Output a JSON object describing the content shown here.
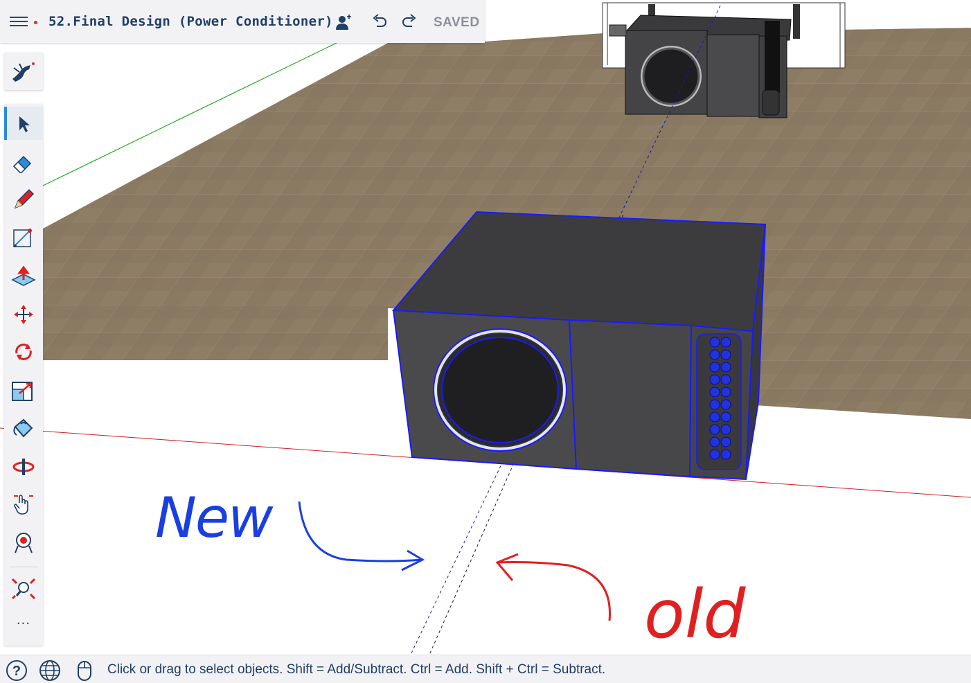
{
  "document": {
    "title": "52.Final Design (Power Conditioner)",
    "unsaved_indicator_color": "#d0342c"
  },
  "header": {
    "saved_label": "SAVED",
    "icons": [
      "menu-icon",
      "add-collaborator-icon",
      "undo-icon",
      "redo-icon"
    ]
  },
  "toolbar": {
    "tools": [
      {
        "name": "select-tool",
        "icon": "arrow-cursor-icon",
        "active": true
      },
      {
        "name": "eraser-tool",
        "icon": "eraser-icon"
      },
      {
        "name": "pencil-tool",
        "icon": "pencil-icon"
      },
      {
        "name": "tape-measure-tool",
        "icon": "measure-icon"
      },
      {
        "name": "push-pull-tool",
        "icon": "push-pull-icon"
      },
      {
        "name": "move-tool",
        "icon": "move-arrows-icon"
      },
      {
        "name": "rotate-tool",
        "icon": "rotate-icon"
      },
      {
        "name": "scale-tool",
        "icon": "scale-icon"
      },
      {
        "name": "paint-bucket-tool",
        "icon": "paint-bucket-icon"
      },
      {
        "name": "orbit-tool",
        "icon": "orbit-icon"
      },
      {
        "name": "pan-tool",
        "icon": "pan-hand-icon"
      },
      {
        "name": "walk-tool",
        "icon": "position-camera-icon"
      },
      {
        "name": "zoom-extents-tool",
        "icon": "zoom-extents-icon"
      }
    ],
    "more_label": "···"
  },
  "annotations": {
    "new_label": "New",
    "old_label": "old",
    "new_color": "#1a3fe0",
    "old_color": "#e02020"
  },
  "status": {
    "text": "Click or drag to select objects. Shift = Add/Subtract. Ctrl = Add. Shift + Ctrl = Subtract.",
    "icons": [
      "help-icon",
      "globe-icon",
      "mouse-icon"
    ]
  },
  "colors": {
    "accent": "#2a8bd8",
    "selection": "#1a1aff",
    "ground": "#8c7a62"
  }
}
